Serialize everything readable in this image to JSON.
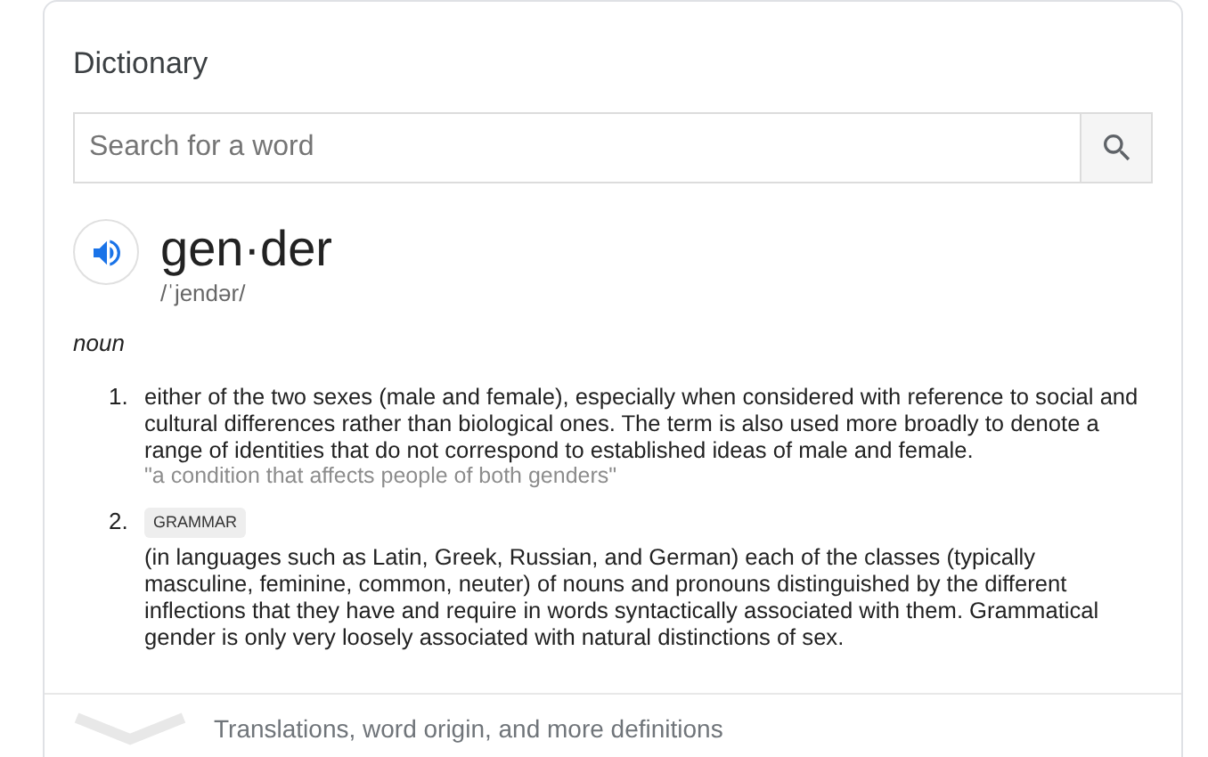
{
  "card": {
    "title": "Dictionary"
  },
  "search": {
    "placeholder": "Search for a word"
  },
  "entry": {
    "word": "gen·der",
    "pronunciation": "/ˈjendər/",
    "part_of_speech": "noun"
  },
  "definitions": [
    {
      "number": "1.",
      "text": "either of the two sexes (male and female), especially when considered with reference to social and cultural differences rather than biological ones. The term is also used more broadly to denote a range of identities that do not correspond to established ideas of male and female.",
      "example": "\"a condition that affects people of both genders\""
    },
    {
      "number": "2.",
      "label": "GRAMMAR",
      "text": "(in languages such as Latin, Greek, Russian, and German) each of the classes (typically masculine, feminine, common, neuter) of nouns and pronouns distinguished by the different inflections that they have and require in words syntactically associated with them. Grammatical gender is only very loosely associated with natural distinctions of sex."
    }
  ],
  "footer": {
    "text": "Translations, word origin, and more definitions",
    "expanded": false
  }
}
